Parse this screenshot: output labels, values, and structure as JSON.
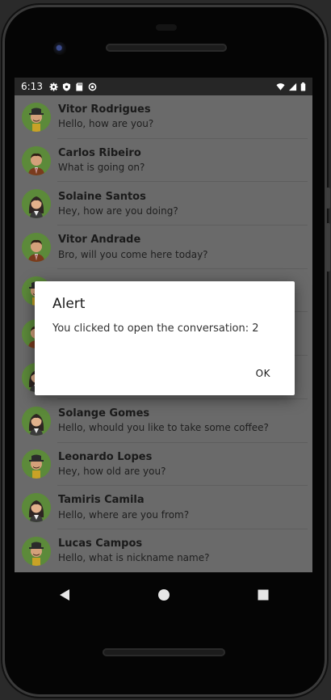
{
  "status_bar": {
    "time": "6:13",
    "icons_left": [
      "gear-icon",
      "shield-icon",
      "sd-card-icon",
      "sync-icon"
    ],
    "icons_right": [
      "wifi-icon",
      "signal-icon",
      "battery-icon"
    ]
  },
  "conversations": [
    {
      "name": "Vitor Rodrigues",
      "message": "Hello, how are you?",
      "avatar": "man-hat"
    },
    {
      "name": "Carlos Ribeiro",
      "message": "What is going on?",
      "avatar": "man-suit"
    },
    {
      "name": "Solaine Santos",
      "message": "Hey, how are you doing?",
      "avatar": "woman"
    },
    {
      "name": "Vitor Andrade",
      "message": "Bro, will you come here today?",
      "avatar": "man-suit"
    },
    {
      "name": "",
      "message": "",
      "avatar": "man-hat"
    },
    {
      "name": "",
      "message": "",
      "avatar": "man-suit"
    },
    {
      "name": "",
      "message": "",
      "avatar": "woman"
    },
    {
      "name": "Solange Gomes",
      "message": "Hello, whould you like to take some coffee?",
      "avatar": "woman"
    },
    {
      "name": "Leonardo Lopes",
      "message": "Hey, how old are you?",
      "avatar": "man-hat"
    },
    {
      "name": "Tamiris Camila",
      "message": "Hello, where are you from?",
      "avatar": "woman"
    },
    {
      "name": "Lucas Campos",
      "message": "Hello, what is nickname name?",
      "avatar": "man-hat"
    }
  ],
  "dialog": {
    "title": "Alert",
    "message": "You clicked to open the conversation: 2",
    "ok_label": "OK"
  },
  "nav": [
    "back-icon",
    "home-icon",
    "recents-icon"
  ],
  "colors": {
    "screen_dim": "#6a6a6a",
    "status_bar": "#262626",
    "avatar_bg": "#5c8a3a"
  }
}
